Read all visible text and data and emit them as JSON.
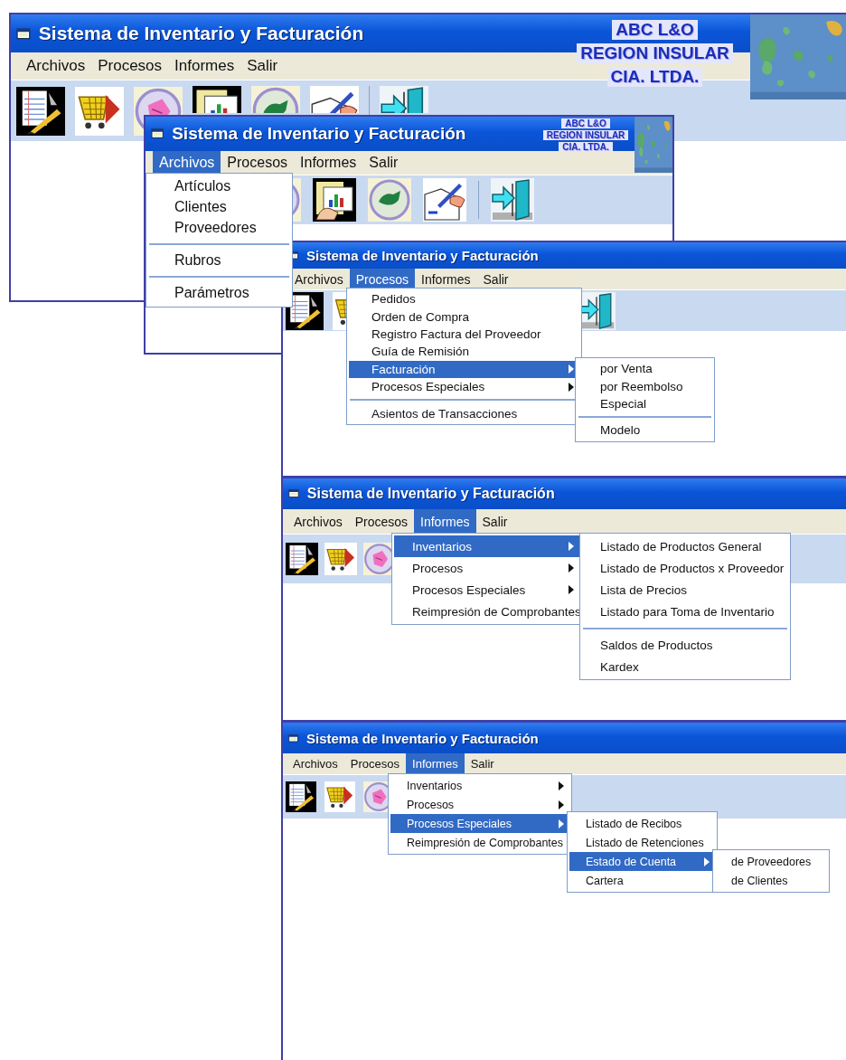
{
  "windows": [
    {
      "title": "Sistema de Inventario y Facturación",
      "logo": {
        "lines": [
          "ABC L&O",
          "REGION INSULAR",
          "CIA. LTDA."
        ],
        "image": {
          "kind": "picture"
        }
      },
      "menu_bar": [
        {
          "label": "Archivos",
          "selected": false
        },
        {
          "label": "Procesos",
          "selected": false
        },
        {
          "label": "Informes",
          "selected": false
        },
        {
          "label": "Salir",
          "selected": false
        }
      ]
    },
    {
      "title": "Sistema de Inventario y Facturación",
      "logo": {
        "lines": [
          "ABC L&O",
          "REGION INSULAR",
          "CIA. LTDA."
        ],
        "image": {
          "kind": "picture"
        }
      },
      "menu_bar": [
        {
          "label": "Archivos",
          "selected": true
        },
        {
          "label": "Procesos",
          "selected": false
        },
        {
          "label": "Informes",
          "selected": false
        },
        {
          "label": "Salir",
          "selected": false
        }
      ],
      "menus": [
        {
          "items": [
            {
              "kind": "item",
              "label": "Artículos",
              "selected": false,
              "has_submenu": false
            },
            {
              "kind": "item",
              "label": "Clientes",
              "selected": false,
              "has_submenu": false
            },
            {
              "kind": "item",
              "label": "Proveedores",
              "selected": false,
              "has_submenu": false
            },
            {
              "kind": "separator"
            },
            {
              "kind": "item",
              "label": "Rubros",
              "selected": false,
              "has_submenu": false
            },
            {
              "kind": "separator"
            },
            {
              "kind": "item",
              "label": "Parámetros",
              "selected": false,
              "has_submenu": false
            }
          ]
        }
      ]
    },
    {
      "title": "Sistema de Inventario y Facturación",
      "menu_bar": [
        {
          "label": "Archivos",
          "selected": false
        },
        {
          "label": "Procesos",
          "selected": true
        },
        {
          "label": "Informes",
          "selected": false
        },
        {
          "label": "Salir",
          "selected": false
        }
      ],
      "menus": [
        {
          "items": [
            {
              "kind": "item",
              "label": "Pedidos",
              "selected": false,
              "has_submenu": false
            },
            {
              "kind": "item",
              "label": "Orden de Compra",
              "selected": false,
              "has_submenu": false
            },
            {
              "kind": "item",
              "label": "Registro Factura del Proveedor",
              "selected": false,
              "has_submenu": false
            },
            {
              "kind": "item",
              "label": "Guía de Remisión",
              "selected": false,
              "has_submenu": false
            },
            {
              "kind": "item",
              "label": "Facturación",
              "selected": true,
              "has_submenu": true
            },
            {
              "kind": "item",
              "label": "Procesos Especiales",
              "selected": false,
              "has_submenu": true
            },
            {
              "kind": "separator"
            },
            {
              "kind": "item",
              "label": "Asientos de Transacciones",
              "selected": false,
              "has_submenu": false
            }
          ]
        },
        {
          "items": [
            {
              "kind": "item",
              "label": "por Venta",
              "selected": false,
              "has_submenu": false
            },
            {
              "kind": "item",
              "label": "por Reembolso",
              "selected": false,
              "has_submenu": false
            },
            {
              "kind": "item",
              "label": "Especial",
              "selected": false,
              "has_submenu": false
            },
            {
              "kind": "separator"
            },
            {
              "kind": "item",
              "label": "Modelo",
              "selected": false,
              "has_submenu": false
            }
          ]
        }
      ]
    },
    {
      "title": "Sistema de Inventario y Facturación",
      "menu_bar": [
        {
          "label": "Archivos",
          "selected": false
        },
        {
          "label": "Procesos",
          "selected": false
        },
        {
          "label": "Informes",
          "selected": true
        },
        {
          "label": "Salir",
          "selected": false
        }
      ],
      "menus": [
        {
          "items": [
            {
              "kind": "item",
              "label": "Inventarios",
              "selected": true,
              "has_submenu": true
            },
            {
              "kind": "item",
              "label": "Procesos",
              "selected": false,
              "has_submenu": true
            },
            {
              "kind": "item",
              "label": "Procesos Especiales",
              "selected": false,
              "has_submenu": true
            },
            {
              "kind": "item",
              "label": "Reimpresión de Comprobantes",
              "selected": false,
              "has_submenu": false
            }
          ]
        },
        {
          "items": [
            {
              "kind": "item",
              "label": "Listado de Productos General",
              "selected": false,
              "has_submenu": false
            },
            {
              "kind": "item",
              "label": "Listado de Productos x Proveedor",
              "selected": false,
              "has_submenu": false
            },
            {
              "kind": "item",
              "label": "Lista de Precios",
              "selected": false,
              "has_submenu": false
            },
            {
              "kind": "item",
              "label": "Listado para Toma de Inventario",
              "selected": false,
              "has_submenu": false
            },
            {
              "kind": "separator"
            },
            {
              "kind": "item",
              "label": "Saldos de Productos",
              "selected": false,
              "has_submenu": false
            },
            {
              "kind": "item",
              "label": "Kardex",
              "selected": false,
              "has_submenu": false
            }
          ]
        }
      ]
    },
    {
      "title": "Sistema de Inventario y Facturación",
      "menu_bar": [
        {
          "label": "Archivos",
          "selected": false
        },
        {
          "label": "Procesos",
          "selected": false
        },
        {
          "label": "Informes",
          "selected": true
        },
        {
          "label": "Salir",
          "selected": false
        }
      ],
      "menus": [
        {
          "items": [
            {
              "kind": "item",
              "label": "Inventarios",
              "selected": false,
              "has_submenu": true
            },
            {
              "kind": "item",
              "label": "Procesos",
              "selected": false,
              "has_submenu": true
            },
            {
              "kind": "item",
              "label": "Procesos Especiales",
              "selected": true,
              "has_submenu": true
            },
            {
              "kind": "item",
              "label": "Reimpresión de Comprobantes",
              "selected": false,
              "has_submenu": false
            }
          ]
        },
        {
          "items": [
            {
              "kind": "item",
              "label": "Listado de Recibos",
              "selected": false,
              "has_submenu": false
            },
            {
              "kind": "item",
              "label": "Listado de Retenciones",
              "selected": false,
              "has_submenu": false
            },
            {
              "kind": "item",
              "label": "Estado de Cuenta",
              "selected": true,
              "has_submenu": true
            },
            {
              "kind": "item",
              "label": "Cartera",
              "selected": false,
              "has_submenu": false
            }
          ]
        },
        {
          "items": [
            {
              "kind": "item",
              "label": "de Proveedores",
              "selected": false,
              "has_submenu": false
            },
            {
              "kind": "item",
              "label": "de Clientes",
              "selected": false,
              "has_submenu": false
            }
          ]
        }
      ]
    }
  ]
}
